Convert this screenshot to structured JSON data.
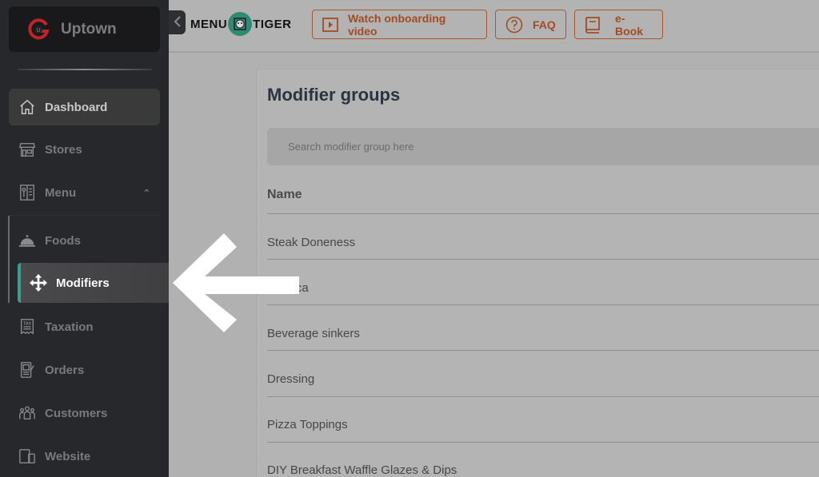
{
  "brand": {
    "name": "Uptown",
    "logo_icon": "uptown-logo-icon"
  },
  "header": {
    "collapse_icon": "chevron-left-icon",
    "logo_text_left": "MENU",
    "logo_text_right": "TIGER",
    "buttons": [
      {
        "label": "Watch onboarding video",
        "icon": "play-video-icon"
      },
      {
        "label": "FAQ",
        "icon": "question-circle-icon"
      },
      {
        "label": "e-Book",
        "icon": "book-icon"
      }
    ],
    "accent_color": "#a24c22"
  },
  "sidebar": {
    "items": [
      {
        "label": "Dashboard",
        "icon": "home-icon",
        "active": true
      },
      {
        "label": "Stores",
        "icon": "store-icon"
      },
      {
        "label": "Menu",
        "icon": "menu-book-icon",
        "expanded": true,
        "chevron": "⌃"
      }
    ],
    "submenu": [
      {
        "label": "Foods",
        "icon": "cloche-icon"
      },
      {
        "label": "Modifiers",
        "icon": "move-arrows-icon",
        "active": true
      }
    ],
    "items_after": [
      {
        "label": "Taxation",
        "icon": "tax-receipt-icon"
      },
      {
        "label": "Orders",
        "icon": "orders-icon"
      },
      {
        "label": "Customers",
        "icon": "customers-icon"
      },
      {
        "label": "Website",
        "icon": "devices-icon"
      }
    ],
    "active_indicator_color": "#3aa08e"
  },
  "main": {
    "title": "Modifier groups",
    "search_placeholder": "Search modifier group here",
    "column_header": "Name",
    "rows": [
      "Steak Doneness",
      "Tapioca",
      "Beverage sinkers",
      "Dressing",
      "Pizza Toppings",
      "DIY Breakfast Waffle Glazes & Dips"
    ]
  },
  "overlay": {
    "arrow": "left-pointing-arrow-annotation"
  }
}
